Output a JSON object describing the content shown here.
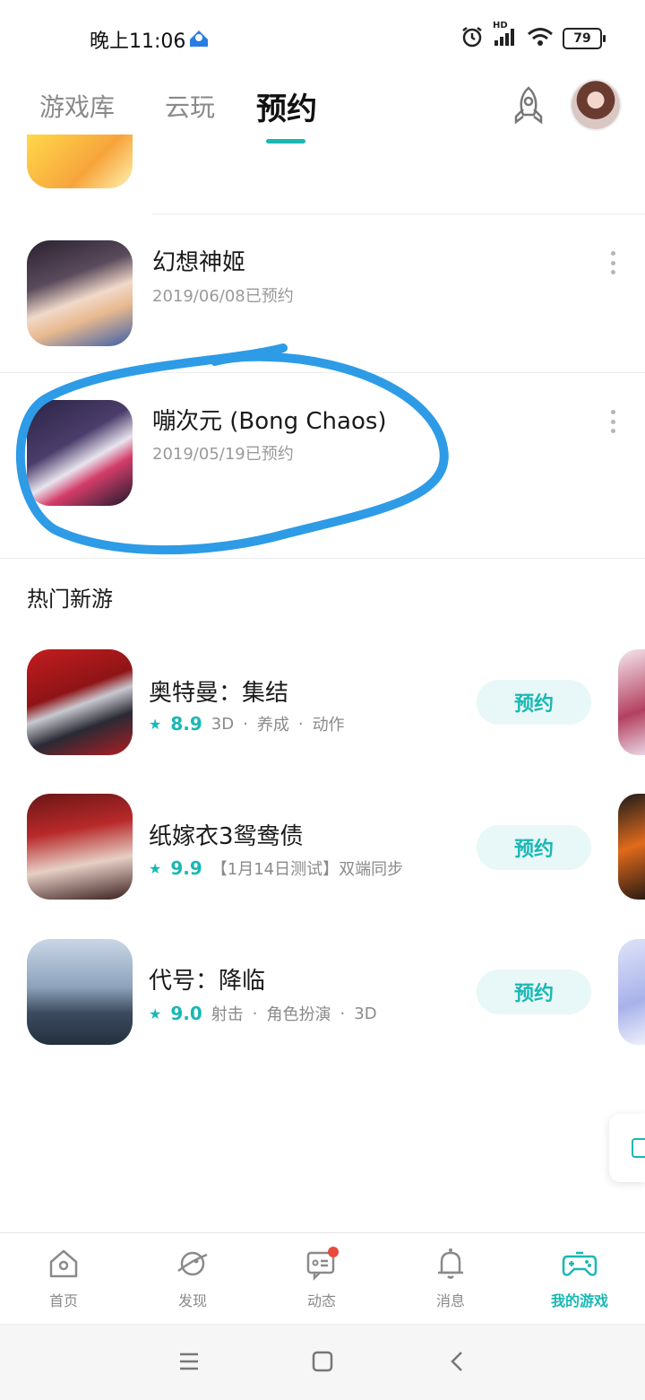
{
  "status_bar": {
    "time": "晚上11:06",
    "network": "HD",
    "battery": "79"
  },
  "tabs": [
    {
      "label": "游戏库"
    },
    {
      "label": "云玩"
    },
    {
      "label": "预约"
    }
  ],
  "reserved": [
    {
      "title": "幻想神姬",
      "date": "2019/06/08已预约"
    },
    {
      "title": "嘣次元 (Bong Chaos)",
      "date": "2019/05/19已预约"
    }
  ],
  "hot_section": {
    "title": "热门新游"
  },
  "hot_games": [
    {
      "title": "奥特曼：集结",
      "score": "8.9",
      "tags": [
        "3D",
        "养成",
        "动作"
      ],
      "button": "预约"
    },
    {
      "title": "纸嫁衣3鸳鸯债",
      "score": "9.9",
      "note": "【1月14日测试】双端同步",
      "button": "预约"
    },
    {
      "title": "代号：降临",
      "score": "9.0",
      "tags": [
        "射击",
        "角色扮演",
        "3D"
      ],
      "button": "预约"
    }
  ],
  "bottom_nav": [
    {
      "label": "首页",
      "icon": "home-icon"
    },
    {
      "label": "发现",
      "icon": "planet-icon"
    },
    {
      "label": "动态",
      "icon": "chat-icon"
    },
    {
      "label": "消息",
      "icon": "bell-icon"
    },
    {
      "label": "我的游戏",
      "icon": "gamepad-icon"
    }
  ],
  "colors": {
    "accent": "#19b8b4",
    "highlight_circle": "#2e9be6",
    "badge": "#e84a3c"
  }
}
